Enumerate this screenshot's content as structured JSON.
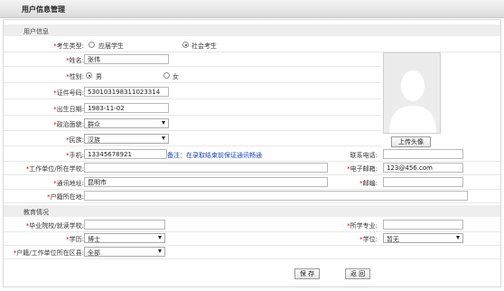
{
  "page_title": "用户信息管理",
  "sections": {
    "user_info": "用户信息",
    "education": "教育情况"
  },
  "fields": {
    "candidate_type": {
      "label": "考生类型:",
      "options": [
        "应届学生",
        "社会考生"
      ],
      "selected": "社会考生"
    },
    "name": {
      "label": "姓名:",
      "value": "张伟"
    },
    "gender": {
      "label": "性别:",
      "options": [
        "男",
        "女"
      ],
      "selected": "男"
    },
    "id_number": {
      "label": "证件号码:",
      "value": "530103198311023314"
    },
    "birth_date": {
      "label": "出生日期:",
      "value": "1983-11-02"
    },
    "politics": {
      "label": "政治面貌:",
      "value": "群众"
    },
    "ethnicity": {
      "label": "民族:",
      "value": "汉族"
    },
    "mobile": {
      "label": "手机:",
      "value": "13345678921",
      "note": "备注：在录取结束前保证通讯畅通"
    },
    "phone": {
      "label": "联系电话:",
      "value": ""
    },
    "employer": {
      "label": "工作单位/所在学校:",
      "value": ""
    },
    "email": {
      "label": "电子邮箱:",
      "value": "123@456.com"
    },
    "address": {
      "label": "通讯地址:",
      "value": "昆明市"
    },
    "postcode": {
      "label": "邮编:",
      "value": ""
    },
    "hukou": {
      "label": "户籍所在地:",
      "value": ""
    },
    "graduated_school": {
      "label": "毕业院校/就读学校:",
      "value": ""
    },
    "major": {
      "label": "所学专业:",
      "value": ""
    },
    "education_level": {
      "label": "学历:",
      "value": "博士"
    },
    "degree": {
      "label": "学位:",
      "value": "暂无"
    },
    "hukou_district": {
      "label": "户籍/工作单位所在区县:",
      "value": "全部"
    }
  },
  "buttons": {
    "upload_avatar": "上传头像",
    "save": "保 存",
    "back": "返 回"
  },
  "colors": {
    "required": "#d9000f",
    "note": "#1a46b8"
  }
}
